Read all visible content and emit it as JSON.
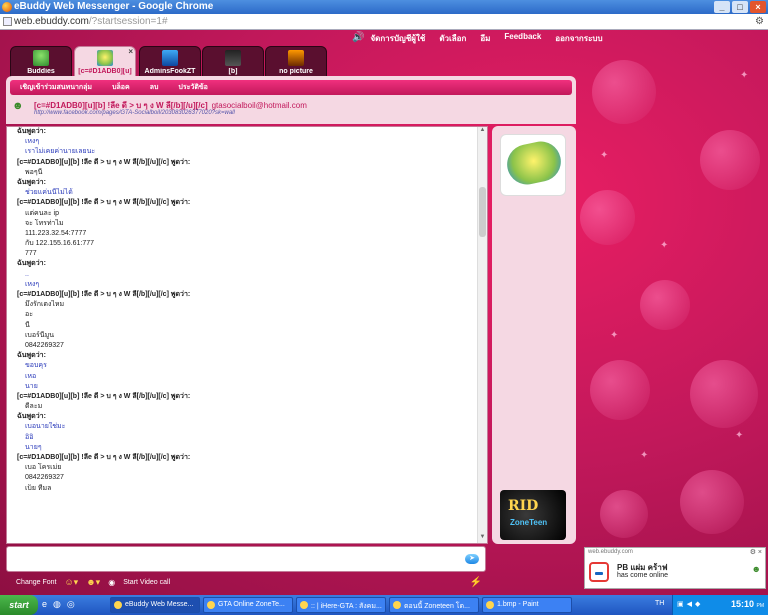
{
  "window": {
    "title": "eBuddy Web Messenger - Google Chrome",
    "url_host": "web.ebuddy.com",
    "url_path": "/?startsession=1#"
  },
  "topnav": {
    "items": [
      "จัดการบัญชีผู้ใช้",
      "ตัวเลือก",
      "อีม",
      "Feedback",
      "ออกจากระบบ"
    ]
  },
  "tabs": [
    {
      "label": "Buddies",
      "active": false
    },
    {
      "label": "[c=#D1ADB0][u]",
      "active": true
    },
    {
      "label": "AdminsFookZT",
      "active": false
    },
    {
      "label": "[b]",
      "active": false
    },
    {
      "label": "no picture",
      "active": false
    }
  ],
  "menubar": {
    "items": [
      "เชิญเข้าร่วมสนทนากลุ่ม",
      "บล็อค",
      "ลบ",
      "ประวัติข้อ"
    ]
  },
  "contact": {
    "name": "[c=#D1ADB0][u][b] !ลีe ดี > บ ๆ ง W ลี[/b][/u][/c]",
    "email": "gtasocialboil@hotmail.com",
    "status": "http://www.facebook.com/pages/GTA-Socialboil/203083026377020?sk=wall"
  },
  "chat": {
    "lines": [
      {
        "t": "ฉันพูดว่า:",
        "k": "nick"
      },
      {
        "t": "เหงๆ",
        "k": "mine"
      },
      {
        "t": "เราไม่เคยค่านายเลยนะ",
        "k": "mine"
      },
      {
        "t": "[c=#D1ADB0][u][b] !ลีe ดี > บ ๆ ง W ลี[/b][/u][/c] พูดว่า:",
        "k": "nick"
      },
      {
        "t": "พอๆนี้",
        "k": "msg"
      },
      {
        "t": "ฉันพูดว่า:",
        "k": "nick"
      },
      {
        "t": "ช่วยแค่นนี้ไม่ได้",
        "k": "mine"
      },
      {
        "t": "[c=#D1ADB0][u][b] !ลีe ดี > บ ๆ ง W ลี[/b][/u][/c] พูดว่า:",
        "k": "nick"
      },
      {
        "t": "แต่คนละ ip",
        "k": "msg"
      },
      {
        "t": "จะ โทรท่าไม",
        "k": "msg"
      },
      {
        "t": "111.223.32.54:7777",
        "k": "msg"
      },
      {
        "t": "กับ 122.155.16.61:777",
        "k": "msg"
      },
      {
        "t": "777",
        "k": "msg"
      },
      {
        "t": "ฉันพูดว่า:",
        "k": "nick"
      },
      {
        "t": "..",
        "k": "mine"
      },
      {
        "t": "เหงๆ",
        "k": "mine"
      },
      {
        "t": "[c=#D1ADB0][u][b] !ลีe ดี > บ ๆ ง W ลี[/b][/u][/c] พูดว่า:",
        "k": "nick"
      },
      {
        "t": "มึงรักเตงไหม",
        "k": "msg"
      },
      {
        "t": "อะ",
        "k": "msg"
      },
      {
        "t": "นี้",
        "k": "msg"
      },
      {
        "t": "เบอร์นี้มูน",
        "k": "msg"
      },
      {
        "t": "0842269327",
        "k": "msg"
      },
      {
        "t": "ฉันพูดว่า:",
        "k": "nick"
      },
      {
        "t": "ขอบคุร",
        "k": "mine"
      },
      {
        "t": "เหอ",
        "k": "mine"
      },
      {
        "t": "นาย",
        "k": "mine"
      },
      {
        "t": "[c=#D1ADB0][u][b] !ลีe ดี > บ ๆ ง W ลี[/b][/u][/c] พูดว่า:",
        "k": "nick"
      },
      {
        "t": "ดีละม",
        "k": "msg"
      },
      {
        "t": "ฉันพูดว่า:",
        "k": "nick"
      },
      {
        "t": "เบอนายใช่มะ",
        "k": "mine"
      },
      {
        "t": "อิอิ",
        "k": "mine"
      },
      {
        "t": "นายๆ",
        "k": "mine"
      },
      {
        "t": "[c=#D1ADB0][u][b] !ลีe ดี > บ ๆ ง W ลี[/b][/u][/c] พูดว่า:",
        "k": "nick"
      },
      {
        "t": "เบอ โครเม่ย",
        "k": "msg"
      },
      {
        "t": "0842269327",
        "k": "msg"
      },
      {
        "t": "เบ็ย ทีมล",
        "k": "msg"
      }
    ]
  },
  "ads": {
    "ad2_title": "RID",
    "ad2_sub": "ZoneTeen"
  },
  "input": {
    "tools": {
      "change_font": "Change Font",
      "start_video": "Start Video call"
    }
  },
  "notification": {
    "source": "web.ebuddy.com",
    "who": "PB แผ่ม คร้าฟ",
    "what": "has come online"
  },
  "taskbar": {
    "start": "start",
    "tasks": [
      {
        "label": "eBuddy Web Messe...",
        "active": true
      },
      {
        "label": "GTA Online ZoneTe...",
        "active": false
      },
      {
        "label": ":: | iHere-GTA : สังคม...",
        "active": false
      },
      {
        "label": "ตอนนี้ Zoneteen โต...",
        "active": false
      },
      {
        "label": "1.bmp - Paint",
        "active": false
      }
    ],
    "lang": "TH",
    "time": "15:10",
    "ampm": "PM"
  }
}
